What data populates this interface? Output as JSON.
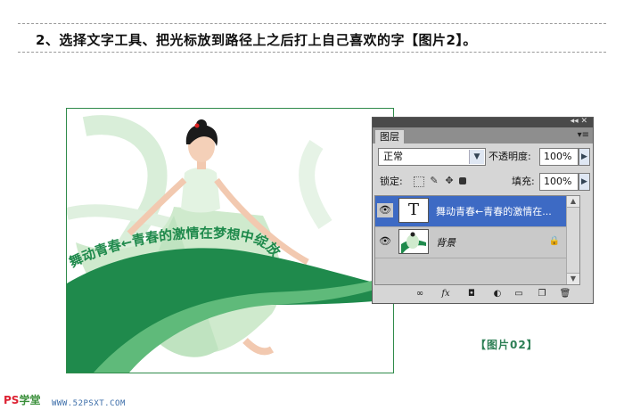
{
  "instruction": "2、选择文字工具、把光标放到路径上之后打上自己喜欢的字【图片2】。",
  "figure_caption": "【图片02】",
  "watermark": {
    "logo_ps": "PS",
    "logo_rest": "学堂",
    "site": "WWW.52PSXT.COM"
  },
  "photo": {
    "path_text": "舞动青春←青春的激情在梦想中绽放",
    "ribbon_color": "#1f8a4c"
  },
  "layers_panel": {
    "title_controls": "◂◂ ✕",
    "tab_label": "图层",
    "menu_icon": "▾≡",
    "blend_mode": "正常",
    "opacity_label": "不透明度:",
    "opacity_value": "100%",
    "lock_label": "锁定:",
    "fill_label": "填充:",
    "fill_value": "100%",
    "layers": [
      {
        "name": "舞动青春←青春的激情在...",
        "thumb": "T",
        "selected": true
      },
      {
        "name": "背景",
        "thumb": "",
        "selected": false
      }
    ],
    "selected_color": "#3d6ac4"
  }
}
